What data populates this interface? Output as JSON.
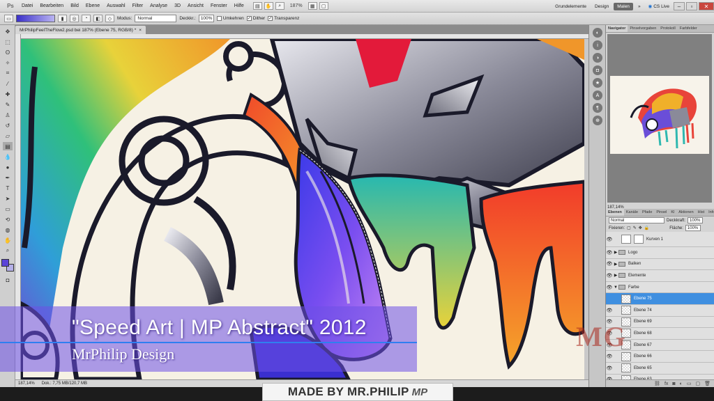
{
  "menubar": {
    "app_logo": "Ps",
    "items": [
      "Datei",
      "Bearbeiten",
      "Bild",
      "Ebene",
      "Auswahl",
      "Filter",
      "Analyse",
      "3D",
      "Ansicht",
      "Fenster",
      "Hilfe"
    ],
    "zoom": "187%",
    "workspace": {
      "grundelemente": "Grundelemente",
      "design": "Design",
      "malen": "Malen",
      "more": "»",
      "cslive": "CS Live"
    },
    "window_controls": {
      "minimize": "–",
      "restore": "▫",
      "close": "✕"
    }
  },
  "options": {
    "mode_label": "Modus:",
    "mode_value": "Normal",
    "opacity_label": "Deckkr.:",
    "opacity_value": "100%",
    "reverse_label": "Umkehren",
    "dither_label": "Dither",
    "transparency_label": "Transparenz"
  },
  "document": {
    "tab_title": "MrPhilipFeelTheFlow2.psd bei 187% (Ebene 75, RGB/8) *",
    "tab_close": "×",
    "status_zoom": "187,14%",
    "status_doc": "Dok.: 7,75 MB/120,7 MB"
  },
  "navigator": {
    "tabs": [
      "Navigator",
      "Pinselvorgaben",
      "Protokoll",
      "Farbfelder"
    ],
    "zoom": "187,14%"
  },
  "layers": {
    "tabs": [
      "Ebenen",
      "Kanäle",
      "Pfade",
      "Pinsel",
      "Kl",
      "Aktionen",
      "Hist",
      "Info"
    ],
    "blend_mode": "Normal",
    "opacity_label": "Deckkraft:",
    "opacity_value": "100%",
    "lock_label": "Fixieren:",
    "fill_label": "Fläche:",
    "fill_value": "100%",
    "items": [
      {
        "name": "Kurven 1",
        "type": "adjustment",
        "selected": false
      },
      {
        "name": "Logo",
        "type": "group",
        "selected": false
      },
      {
        "name": "Balken",
        "type": "group",
        "selected": false
      },
      {
        "name": "Elemente",
        "type": "group",
        "selected": false
      },
      {
        "name": "Farbe",
        "type": "group-open",
        "selected": false
      },
      {
        "name": "Ebene 75",
        "type": "layer",
        "selected": true
      },
      {
        "name": "Ebene 74",
        "type": "layer",
        "selected": false
      },
      {
        "name": "Ebene 69",
        "type": "layer",
        "selected": false
      },
      {
        "name": "Ebene 68",
        "type": "layer",
        "selected": false
      },
      {
        "name": "Ebene 67",
        "type": "layer",
        "selected": false
      },
      {
        "name": "Ebene 66",
        "type": "layer",
        "selected": false
      },
      {
        "name": "Ebene 65",
        "type": "layer",
        "selected": false
      },
      {
        "name": "Ebene 63",
        "type": "layer",
        "selected": false
      }
    ]
  },
  "overlay": {
    "title": "\"Speed Art | MP Abstract\" 2012",
    "subtitle": "MrPhilip Design",
    "watermark": "MG",
    "footer": "MADE BY MR.PHILIP",
    "footer_logo": "MP"
  },
  "colors": {
    "foreground": "#5b44d8",
    "background": "#b5b0e8",
    "selection": "#3f8fe0",
    "banner": "#6e50e6"
  }
}
